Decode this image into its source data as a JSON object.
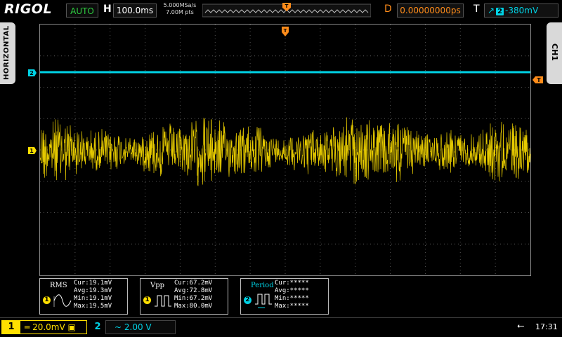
{
  "top": {
    "brand": "RIGOL",
    "run_mode": "AUTO",
    "horizontal_label": "H",
    "timebase": "100.0ms",
    "sample_rate": "5.000MSa/s",
    "memory_depth": "7.00M pts",
    "delay_label": "D",
    "delay_value": "0.00000000ps",
    "trigger_label": "T",
    "trigger_source": "2",
    "trigger_level": "-380mV"
  },
  "side_tabs": {
    "left": "HORIZONTAL",
    "right": "CH1"
  },
  "markers": {
    "trigger_pos": "T",
    "ch2": "2",
    "ch1": "1",
    "trigger_level_marker": "T"
  },
  "measurements": [
    {
      "name": "RMS",
      "source": "1",
      "cur": "Cur:19.1mV",
      "avg": "Avg:19.3mV",
      "min": "Min:19.1mV",
      "max": "Max:19.5mV"
    },
    {
      "name": "Vpp",
      "source": "1",
      "cur": "Cur:67.2mV",
      "avg": "Avg:72.8mV",
      "min": "Min:67.2mV",
      "max": "Max:80.0mV"
    },
    {
      "name": "Period",
      "source": "2",
      "cur": "Cur:*****",
      "avg": "Avg:*****",
      "min": "Min:*****",
      "max": "Max:*****"
    }
  ],
  "bottom": {
    "ch1_num": "1",
    "ch1_scale": "20.0mV",
    "ch2_num": "2",
    "ch2_scale": "2.00 V",
    "clock": "17:31"
  },
  "colors": {
    "ch1": "#ffe000",
    "ch2": "#00d3e6",
    "trigger": "#ff8c1a"
  }
}
